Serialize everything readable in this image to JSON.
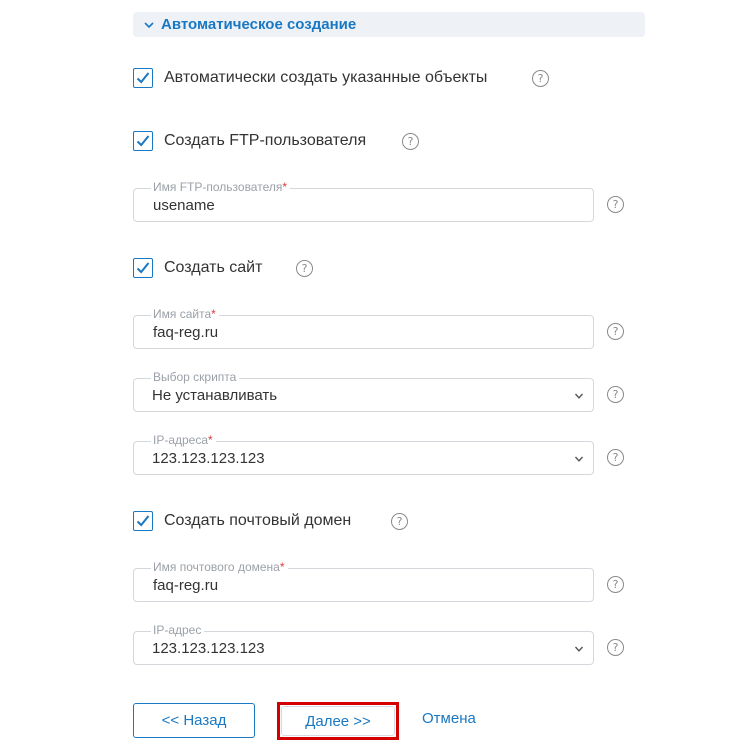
{
  "section": {
    "title": "Автоматическое создание",
    "icon": "chevron-down-icon"
  },
  "auto_create": {
    "label": "Автоматически создать указанные объекты",
    "checked": true
  },
  "ftp": {
    "label": "Создать FTP-пользователя",
    "checked": true,
    "username_label": "Имя FTP-пользователя",
    "username_value": "usename"
  },
  "site": {
    "label": "Создать сайт",
    "checked": true,
    "name_label": "Имя сайта",
    "name_value": "faq-reg.ru",
    "script_label": "Выбор скрипта",
    "script_value": "Не устанавливать",
    "ip_label": "IP-адреса",
    "ip_value": "123.123.123.123"
  },
  "mail": {
    "label": "Создать почтовый домен",
    "checked": true,
    "domain_label": "Имя почтового домена",
    "domain_value": "faq-reg.ru",
    "ip_label": "IP-адрес",
    "ip_value": "123.123.123.123"
  },
  "required_mark": "*",
  "help_glyph": "?",
  "buttons": {
    "back": "<< Назад",
    "next": "Далее >>",
    "cancel": "Отмена"
  },
  "colors": {
    "accent": "#1a78c2",
    "required": "#e2383f",
    "highlight": "#d40000",
    "header_bg": "#eef2f7"
  }
}
